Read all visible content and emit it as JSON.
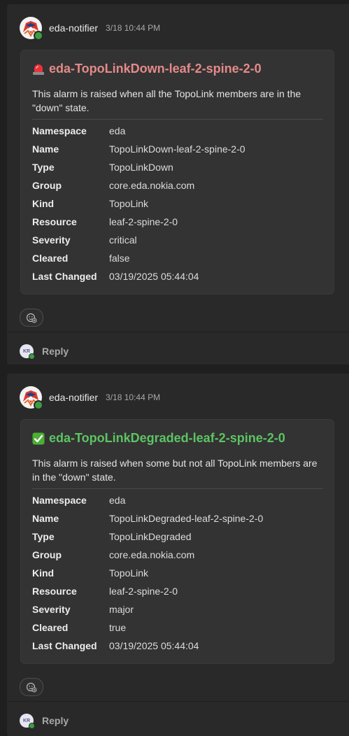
{
  "posts": [
    {
      "sender": "eda-notifier",
      "timestamp": "3/18 10:44 PM",
      "card": {
        "emoji_icon": "rotating-light-icon",
        "title": "eda-TopoLinkDown-leaf-2-spine-2-0",
        "title_color": "#e58a8a",
        "description": "This alarm is raised when all the TopoLink members are in the \"down\" state.",
        "facts": [
          {
            "key": "Namespace",
            "value": "eda"
          },
          {
            "key": "Name",
            "value": "TopoLinkDown-leaf-2-spine-2-0"
          },
          {
            "key": "Type",
            "value": "TopoLinkDown"
          },
          {
            "key": "Group",
            "value": "core.eda.nokia.com"
          },
          {
            "key": "Kind",
            "value": "TopoLink"
          },
          {
            "key": "Resource",
            "value": "leaf-2-spine-2-0"
          },
          {
            "key": "Severity",
            "value": "critical"
          },
          {
            "key": "Cleared",
            "value": "false"
          },
          {
            "key": "Last Changed",
            "value": "03/19/2025 05:44:04"
          }
        ]
      },
      "reply_avatar_initials": "KR",
      "reply_label": "Reply"
    },
    {
      "sender": "eda-notifier",
      "timestamp": "3/18 10:44 PM",
      "card": {
        "emoji_icon": "check-mark-button-icon",
        "title": "eda-TopoLinkDegraded-leaf-2-spine-2-0",
        "title_color": "#5cc463",
        "description": "This alarm is raised when some but not all TopoLink members are in the \"down\" state.",
        "facts": [
          {
            "key": "Namespace",
            "value": "eda"
          },
          {
            "key": "Name",
            "value": "TopoLinkDegraded-leaf-2-spine-2-0"
          },
          {
            "key": "Type",
            "value": "TopoLinkDegraded"
          },
          {
            "key": "Group",
            "value": "core.eda.nokia.com"
          },
          {
            "key": "Kind",
            "value": "TopoLink"
          },
          {
            "key": "Resource",
            "value": "leaf-2-spine-2-0"
          },
          {
            "key": "Severity",
            "value": "major"
          },
          {
            "key": "Cleared",
            "value": "true"
          },
          {
            "key": "Last Changed",
            "value": "03/19/2025 05:44:04"
          }
        ]
      },
      "reply_avatar_initials": "KR",
      "reply_label": "Reply"
    }
  ]
}
